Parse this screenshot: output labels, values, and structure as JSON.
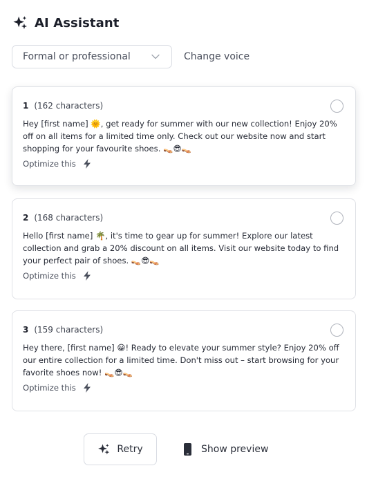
{
  "header": {
    "title": "AI Assistant",
    "icon": "sparkle-icon"
  },
  "voice": {
    "selected": "Formal or professional",
    "change_label": "Change voice"
  },
  "options": [
    {
      "number": "1",
      "characters": "(162 characters)",
      "text": "Hey [first name] 🌞, get ready for summer with our new collection! Enjoy 20% off on all items for a limited time only. Check out our website now and start shopping for your favourite shoes. 👡😎👡",
      "optimize_label": "Optimize this",
      "selected": false
    },
    {
      "number": "2",
      "characters": "(168 characters)",
      "text": "Hello [first name] 🌴, it's time to gear up for summer! Explore our latest collection and grab a 20% discount on all items. Visit our website today to find your perfect pair of shoes. 👡😎👡",
      "optimize_label": "Optimize this",
      "selected": false
    },
    {
      "number": "3",
      "characters": "(159 characters)",
      "text": "Hey there, [first name] 😀! Ready to elevate your summer style? Enjoy 20% off our entire collection for a limited time. Don't miss out – start browsing for your favorite shoes now! 👡😎👡",
      "optimize_label": "Optimize this",
      "selected": false
    }
  ],
  "footer": {
    "retry_label": "Retry",
    "preview_label": "Show preview"
  },
  "colors": {
    "text": "#1c1f2a",
    "muted": "#4a4f5c",
    "border": "#dfe1e6"
  }
}
